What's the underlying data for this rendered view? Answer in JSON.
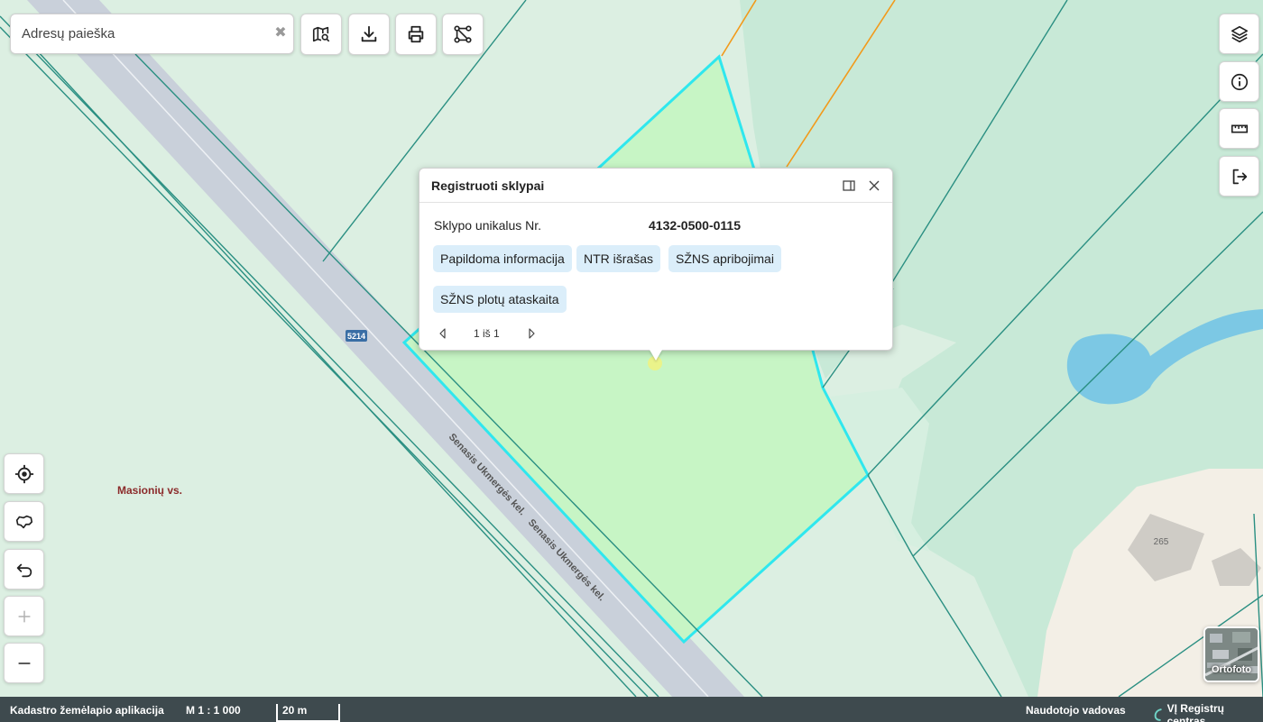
{
  "search": {
    "placeholder": "Adresų paieška"
  },
  "popup": {
    "title": "Registruoti sklypai",
    "field_label": "Sklypo unikalus Nr.",
    "field_value": "4132-0500-0115",
    "buttons": [
      "Papildoma informacija",
      "NTR išrašas",
      "SŽNS apribojimai",
      "SŽNS plotų ataskaita"
    ],
    "pager": "1 iš 1"
  },
  "map": {
    "place_label": "Masionių vs.",
    "road_number": "5214",
    "road_name": "Senasis Ukmergės kel.",
    "house_number": "265"
  },
  "basemap_toggle": "Ortofoto",
  "footer": {
    "app_name": "Kadastro žemėlapio aplikacija",
    "scale": "M 1 : 1 000",
    "scalebar": "20 m",
    "manual": "Naudotojo vadovas",
    "brand": "VĮ Registrų centras"
  },
  "colors": {
    "parcel_outline": "#2fe7ee",
    "parcel_fill": "#c7f5c5",
    "cadastre_lines": "#2a8f82",
    "road": "#c9d0da",
    "water": "#7cc8e4",
    "forest": "#c5e9d6",
    "footer_bg": "#3e4a4e",
    "chip_bg": "#dbeefa"
  }
}
